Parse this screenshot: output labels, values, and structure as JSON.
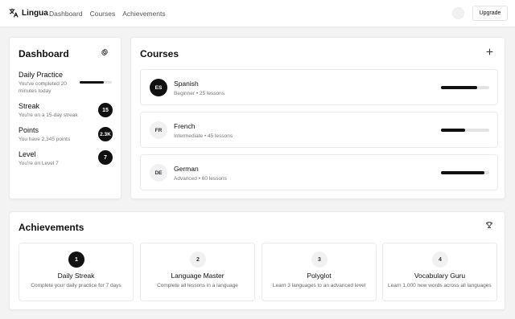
{
  "brand": {
    "name": "Lingua",
    "icon": "translate-icon"
  },
  "nav": [
    "Dashboard",
    "Courses",
    "Achievements"
  ],
  "header": {
    "upgrade_label": "Upgrade"
  },
  "dashboard": {
    "title": "Dashboard",
    "settings_icon": "gear-icon",
    "stats": [
      {
        "label": "Daily Practice",
        "sub": "You've completed 20 minutes today",
        "progress": 0.75
      },
      {
        "label": "Streak",
        "sub": "You're on a 15-day streak",
        "badge": "15"
      },
      {
        "label": "Points",
        "sub": "You have 2,345 points",
        "badge": "2.3K"
      },
      {
        "label": "Level",
        "sub": "You're on Level 7",
        "badge": "7"
      }
    ]
  },
  "courses": {
    "title": "Courses",
    "add_icon": "plus-icon",
    "items": [
      {
        "code": "ES",
        "name": "Spanish",
        "sub": "Beginner • 25 lessons",
        "progress": 0.75,
        "active": true
      },
      {
        "code": "FR",
        "name": "French",
        "sub": "Intermediate • 45 lessons",
        "progress": 0.5,
        "active": false
      },
      {
        "code": "DE",
        "name": "German",
        "sub": "Advanced • 60 lessons",
        "progress": 0.9,
        "active": false
      }
    ]
  },
  "achievements": {
    "title": "Achievements",
    "trophy_icon": "trophy-icon",
    "items": [
      {
        "num": "1",
        "title": "Daily Streak",
        "sub": "Complete your daily practice for 7 days",
        "active": true
      },
      {
        "num": "2",
        "title": "Language Master",
        "sub": "Complete all lessons in a language",
        "active": false
      },
      {
        "num": "3",
        "title": "Polyglot",
        "sub": "Learn 3 languages to an advanced level",
        "active": false
      },
      {
        "num": "4",
        "title": "Vocabulary Guru",
        "sub": "Learn 1,000 new words across all languages",
        "active": false
      }
    ]
  },
  "colors": {
    "accent": "#111111",
    "track": "#e3e3e5",
    "muted_circle": "#f1f1f3"
  }
}
